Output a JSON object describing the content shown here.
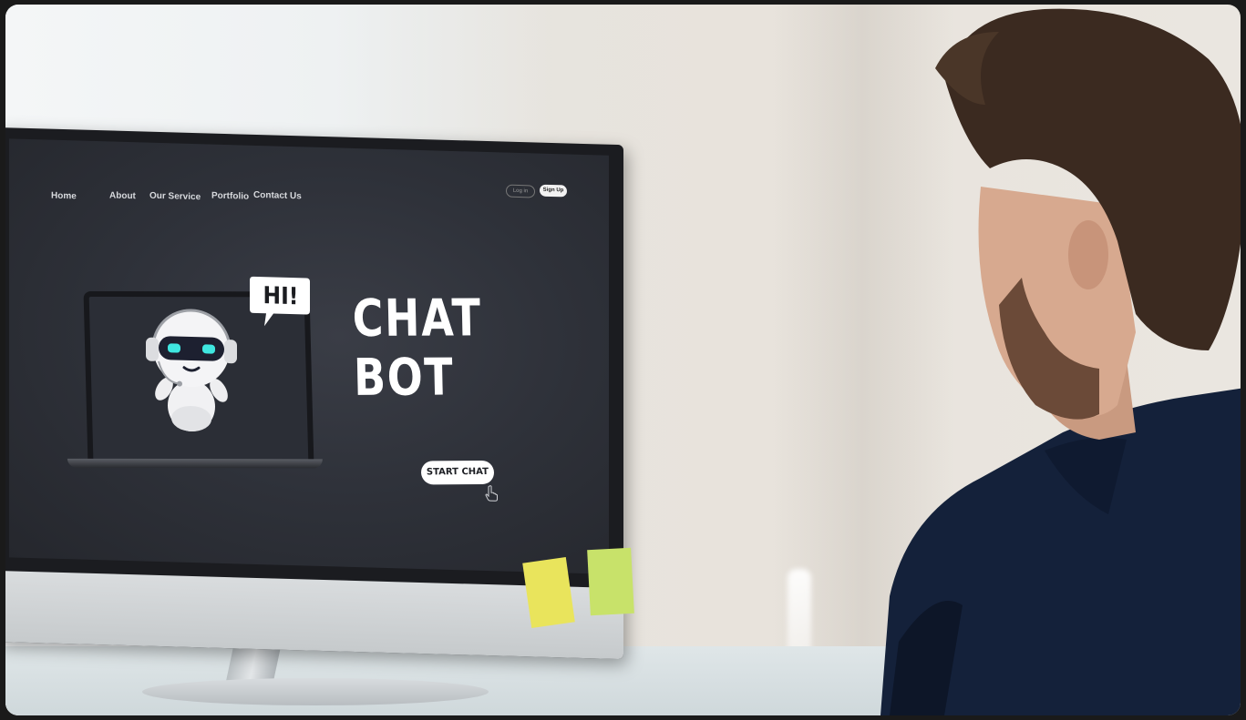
{
  "scene": {
    "description_hidden": "",
    "colors": {
      "screen_bg": "#2e3139",
      "shirt": "#1a2a44",
      "hair": "#3a2a20",
      "sticky_yellow": "#e9e45c",
      "sticky_green": "#c8e26a"
    }
  },
  "website": {
    "nav": {
      "home": "Home",
      "about": "About",
      "service": "Our Service",
      "portfolio": "Portfolio",
      "contact": "Contact Us"
    },
    "login_label": "Log in",
    "signup_label": "Sign Up",
    "headline": "CHAT BOT",
    "speech_bubble": "HI!",
    "cta_label": "START CHAT",
    "icons": {
      "robot": "robot-icon",
      "cursor": "hand-cursor-icon"
    }
  }
}
